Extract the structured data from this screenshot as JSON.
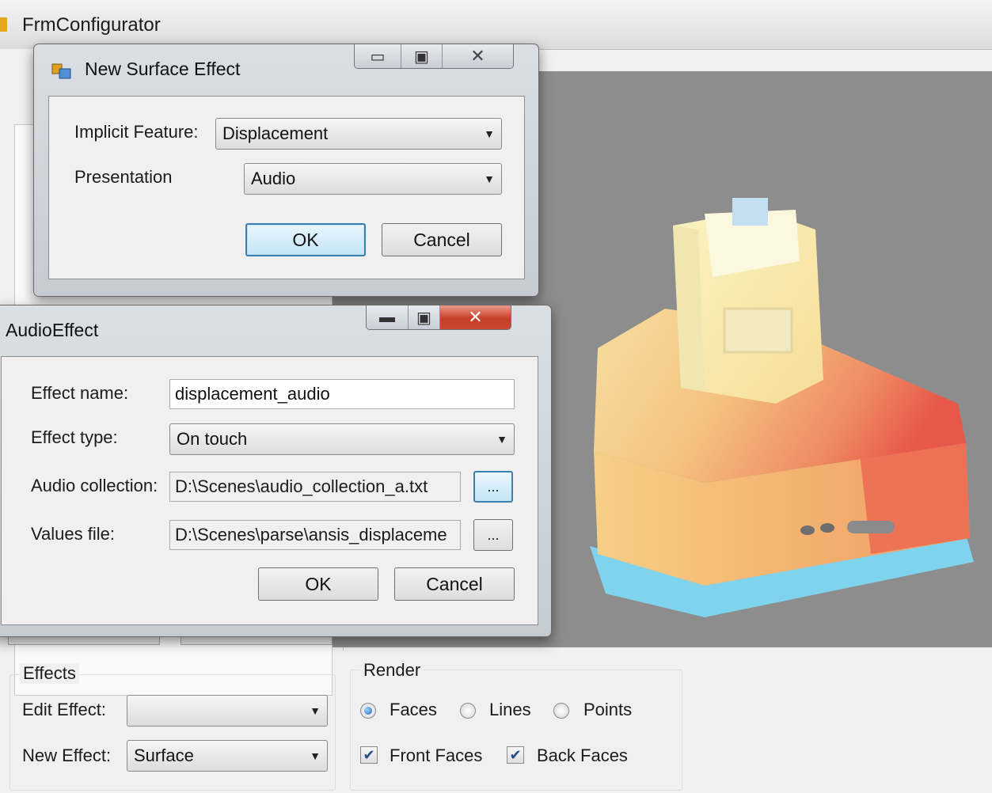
{
  "main_window": {
    "title": "FrmConfigurator"
  },
  "surface_dialog": {
    "title": "New Surface Effect",
    "implicit_feature_label": "Implicit Feature:",
    "implicit_feature_value": "Displacement",
    "presentation_label": "Presentation",
    "presentation_value": "Audio",
    "ok_label": "OK",
    "cancel_label": "Cancel"
  },
  "audio_dialog": {
    "title": "AudioEffect",
    "effect_name_label": "Effect name:",
    "effect_name_value": "displacement_audio",
    "effect_type_label": "Effect type:",
    "effect_type_value": "On touch",
    "audio_collection_label": "Audio collection:",
    "audio_collection_value": "D:\\Scenes\\audio_collection_a.txt",
    "values_file_label": "Values file:",
    "values_file_value": "D:\\Scenes\\parse\\ansis_displaceme",
    "browse_label": "...",
    "ok_label": "OK",
    "cancel_label": "Cancel"
  },
  "effects_group": {
    "title": "Effects",
    "edit_effect_label": "Edit Effect:",
    "edit_effect_value": "",
    "new_effect_label": "New Effect:",
    "new_effect_value": "Surface"
  },
  "render_group": {
    "title": "Render",
    "faces_label": "Faces",
    "lines_label": "Lines",
    "points_label": "Points",
    "render_mode_selected": "Faces",
    "front_faces_label": "Front Faces",
    "back_faces_label": "Back Faces",
    "front_faces_checked": true,
    "back_faces_checked": true
  },
  "icons": {
    "app": "app-icon",
    "dialog": "form-icon",
    "minimize": "minimize-icon",
    "maximize": "maximize-icon",
    "close": "close-icon",
    "dropdown": "chevron-down-icon",
    "check": "checkmark-icon"
  },
  "colors": {
    "viewport_background": "#8d8d8d",
    "close_button": "#c6402a",
    "focus_border": "#3c7fb1"
  }
}
